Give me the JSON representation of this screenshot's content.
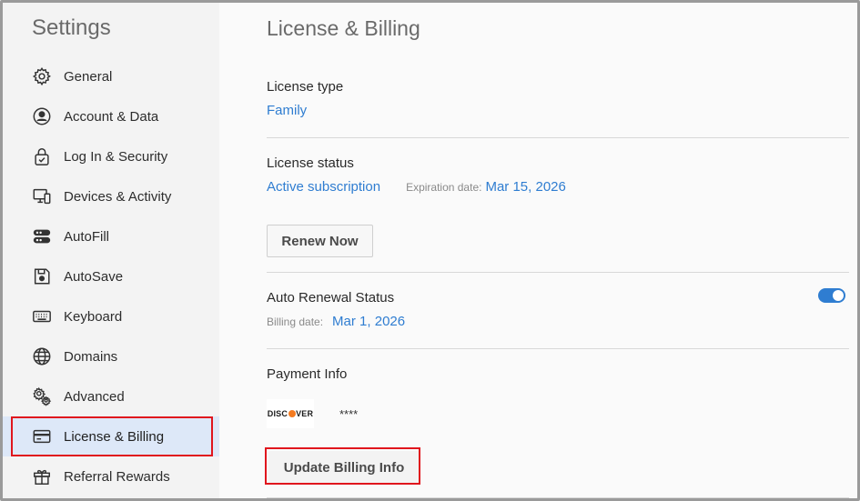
{
  "sidebar": {
    "title": "Settings",
    "items": [
      {
        "label": "General",
        "icon": "gear-icon"
      },
      {
        "label": "Account & Data",
        "icon": "user-circle-icon"
      },
      {
        "label": "Log In & Security",
        "icon": "lock-check-icon"
      },
      {
        "label": "Devices & Activity",
        "icon": "devices-icon"
      },
      {
        "label": "AutoFill",
        "icon": "autofill-icon"
      },
      {
        "label": "AutoSave",
        "icon": "save-icon"
      },
      {
        "label": "Keyboard",
        "icon": "keyboard-icon"
      },
      {
        "label": "Domains",
        "icon": "globe-icon"
      },
      {
        "label": "Advanced",
        "icon": "gears-icon"
      },
      {
        "label": "License & Billing",
        "icon": "credit-card-icon",
        "active": true
      },
      {
        "label": "Referral Rewards",
        "icon": "gift-icon"
      }
    ]
  },
  "main": {
    "title": "License & Billing",
    "license_type": {
      "label": "License type",
      "value": "Family"
    },
    "license_status": {
      "label": "License status",
      "value": "Active subscription",
      "expiration_label": "Expiration date:",
      "expiration_value": "Mar 15, 2026",
      "renew_button": "Renew Now"
    },
    "auto_renewal": {
      "label": "Auto Renewal Status",
      "billing_label": "Billing date:",
      "billing_value": "Mar 1, 2026",
      "enabled": true
    },
    "payment": {
      "label": "Payment Info",
      "card_brand_pre": "DISC",
      "card_brand_post": "VER",
      "card_masked": "****",
      "update_button": "Update Billing Info"
    }
  },
  "colors": {
    "accent": "#2f7dd1",
    "highlight_outline": "#e0161d",
    "active_bg": "#dde8f8",
    "discover_orange": "#f47b20"
  }
}
